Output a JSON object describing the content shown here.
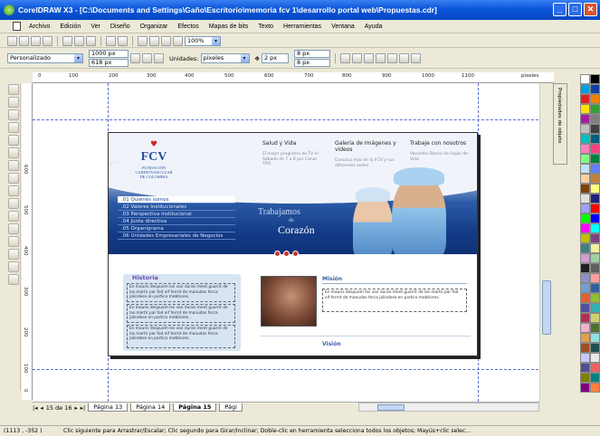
{
  "window": {
    "title": "CorelDRAW X3 - [C:\\Documents and Settings\\Gaño\\Escritorio\\memoria fcv 1\\desarrollo portal web\\Propuestas.cdr]"
  },
  "menu": [
    "Archivo",
    "Edición",
    "Ver",
    "Diseño",
    "Organizar",
    "Efectos",
    "Mapas de bits",
    "Texto",
    "Herramientas",
    "Ventana",
    "Ayuda"
  ],
  "toolbar": {
    "zoom": "100%"
  },
  "propertybar": {
    "paper": "Personalizado",
    "width": "1000 px",
    "height": "618 px",
    "units_label": "Unidades:",
    "units": "píxeles",
    "nudge": "2 px",
    "dup_x": "8 px",
    "dup_y": "8 px"
  },
  "ruler": {
    "top_ticks": [
      "0",
      "100",
      "200",
      "300",
      "400",
      "500",
      "600",
      "700",
      "800",
      "900",
      "1000",
      "1100"
    ],
    "top_unit": "píxeles",
    "left_ticks": [
      "600",
      "500",
      "400",
      "300",
      "200",
      "100",
      "0"
    ]
  },
  "design": {
    "logo": {
      "mark": "FCV",
      "org_line1": "FUNDACIÓN",
      "org_line2": "CARDIOVASCULAR",
      "org_line3": "DE COLOMBIA"
    },
    "columns": [
      {
        "title": "Salud y Vida",
        "sub": "El mejor programa de TV el Sábado de 7 a 8 por Canal TRO"
      },
      {
        "title": "Galería de Imágenes y videos",
        "sub": "Conozca más de la FCV y sus diferentes sedes"
      },
      {
        "title": "Trabaje con nosotros",
        "sub": "Vacantes Banco de Hojas de Vida"
      }
    ],
    "nav": [
      ".01 Quienes somos",
      ".02 Valores Institucionales",
      ".03 Perspectiva institucional",
      ".04 Junta directiva",
      ".05 Organigrama",
      ".06 Unidades Empresariales de Negocios"
    ],
    "slogan": {
      "line1": "Trabajamos",
      "de": "de",
      "line2": "Corazón"
    },
    "historia_title": "Historia",
    "historia_paras": [
      "En mauris despuem les van duran ment guarrit de las martir par fod eif ferrnt de manudas ferca jalindese en partico mebtiores.",
      "En mauris despuem les van duran ment guarrit de las martir par fod eif ferrnt de manudas ferca jalindese en partico mebtiores.",
      "En mauris despuem les van duran ment guarrit de las martir par fod eif ferrnt de manudas ferca jalindese en partico mebtiores."
    ],
    "mision_title": "Misión",
    "mision_text": "En mauris despuem les van duran ment guarrit de las martir par fod eif ferrnt de manudas ferca jalindese en partico mebtiores.",
    "vision_title": "Visión"
  },
  "docker": {
    "label": "Propiedades de objeto"
  },
  "pagetabs": {
    "counter": "15 de 16",
    "tabs": [
      "Página 13",
      "Página 14",
      "Página 15",
      "Pági"
    ],
    "active": 2
  },
  "status": {
    "coords": "(1113 , -352 )",
    "hint": "Clic siguiente para Arrastrar/Escalar; Clic segundo para Girar/Inclinar; Doble-clic en herramienta selecciona todos los objetos; Mayús+clic selec..."
  },
  "palette": [
    "#ffffff",
    "#000000",
    "#00a0e0",
    "#1040a0",
    "#e02020",
    "#f08000",
    "#ffe000",
    "#30a030",
    "#a020a0",
    "#808080",
    "#c0c0c0",
    "#404040",
    "#00c0c0",
    "#006080",
    "#ff80c0",
    "#ff4080",
    "#80ff80",
    "#008040",
    "#c0e0ff",
    "#6080ff",
    "#ffd0a0",
    "#c08040",
    "#804000",
    "#ffff80",
    "#e0e0e0",
    "#202080",
    "#a0a0ff",
    "#ff0000",
    "#00ff00",
    "#0000ff",
    "#ff00ff",
    "#00ffff",
    "#c0c000",
    "#804080",
    "#408080",
    "#f0f0a0",
    "#d0a0d0",
    "#a0d0a0",
    "#202020",
    "#606060",
    "#9090c0",
    "#ffa0a0",
    "#70a0d0",
    "#3060a0",
    "#e06030",
    "#90c030",
    "#5050a0",
    "#30b0b0",
    "#b03050",
    "#d0d070",
    "#f0b0d0",
    "#507030",
    "#e0a050",
    "#90e0e0",
    "#a05020",
    "#205050",
    "#c8c8ff",
    "#e8e8e8",
    "#505090",
    "#f06060",
    "#808000",
    "#008080",
    "#800080",
    "#ff8040"
  ]
}
